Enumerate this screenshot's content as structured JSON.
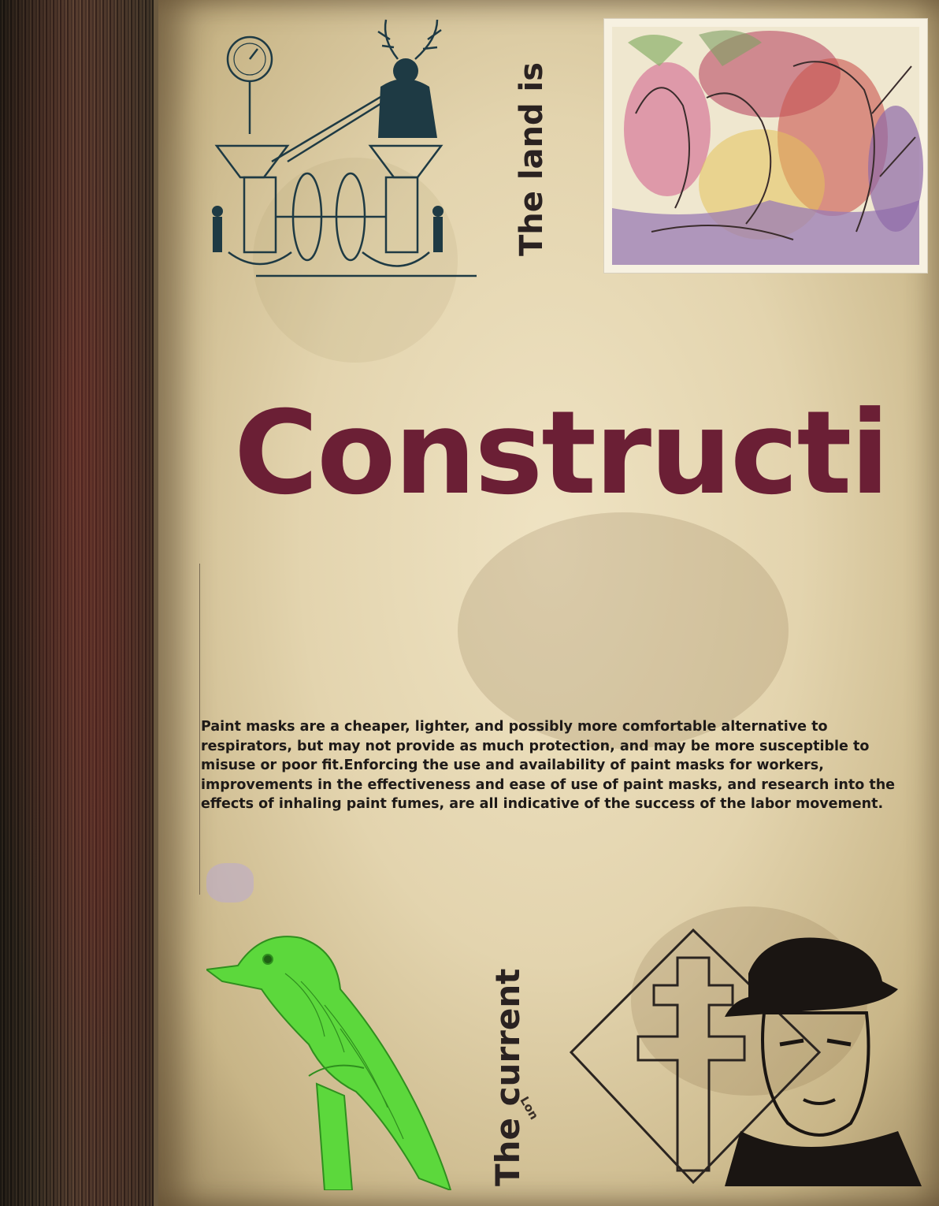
{
  "page": {
    "title": "Constructi",
    "vertical_top": "The land is",
    "vertical_bottom": "The current",
    "small_label": "Lon",
    "body": "Paint masks are a cheaper, lighter, and possibly more comfortable alternative to respirators, but may not provide as much protection, and may be more susceptible to misuse or poor fit.Enforcing the use and availability of paint masks for workers, improvements in the effectiveness and ease of use of paint masks, and research into the effects of inhaling paint fumes, are all indicative of the success of the labor movement."
  },
  "colors": {
    "title": "#6b1f35",
    "text": "#1e1a18",
    "bird": "#5cd83c",
    "engraving": "#1e3a44"
  },
  "images": {
    "top_left": "engraving-machine-antlered-figure",
    "top_right": "abstract-watercolor-painting",
    "bottom_left": "green-bird-engraving",
    "bottom_right": "cross-of-lorraine-man-in-hat"
  }
}
